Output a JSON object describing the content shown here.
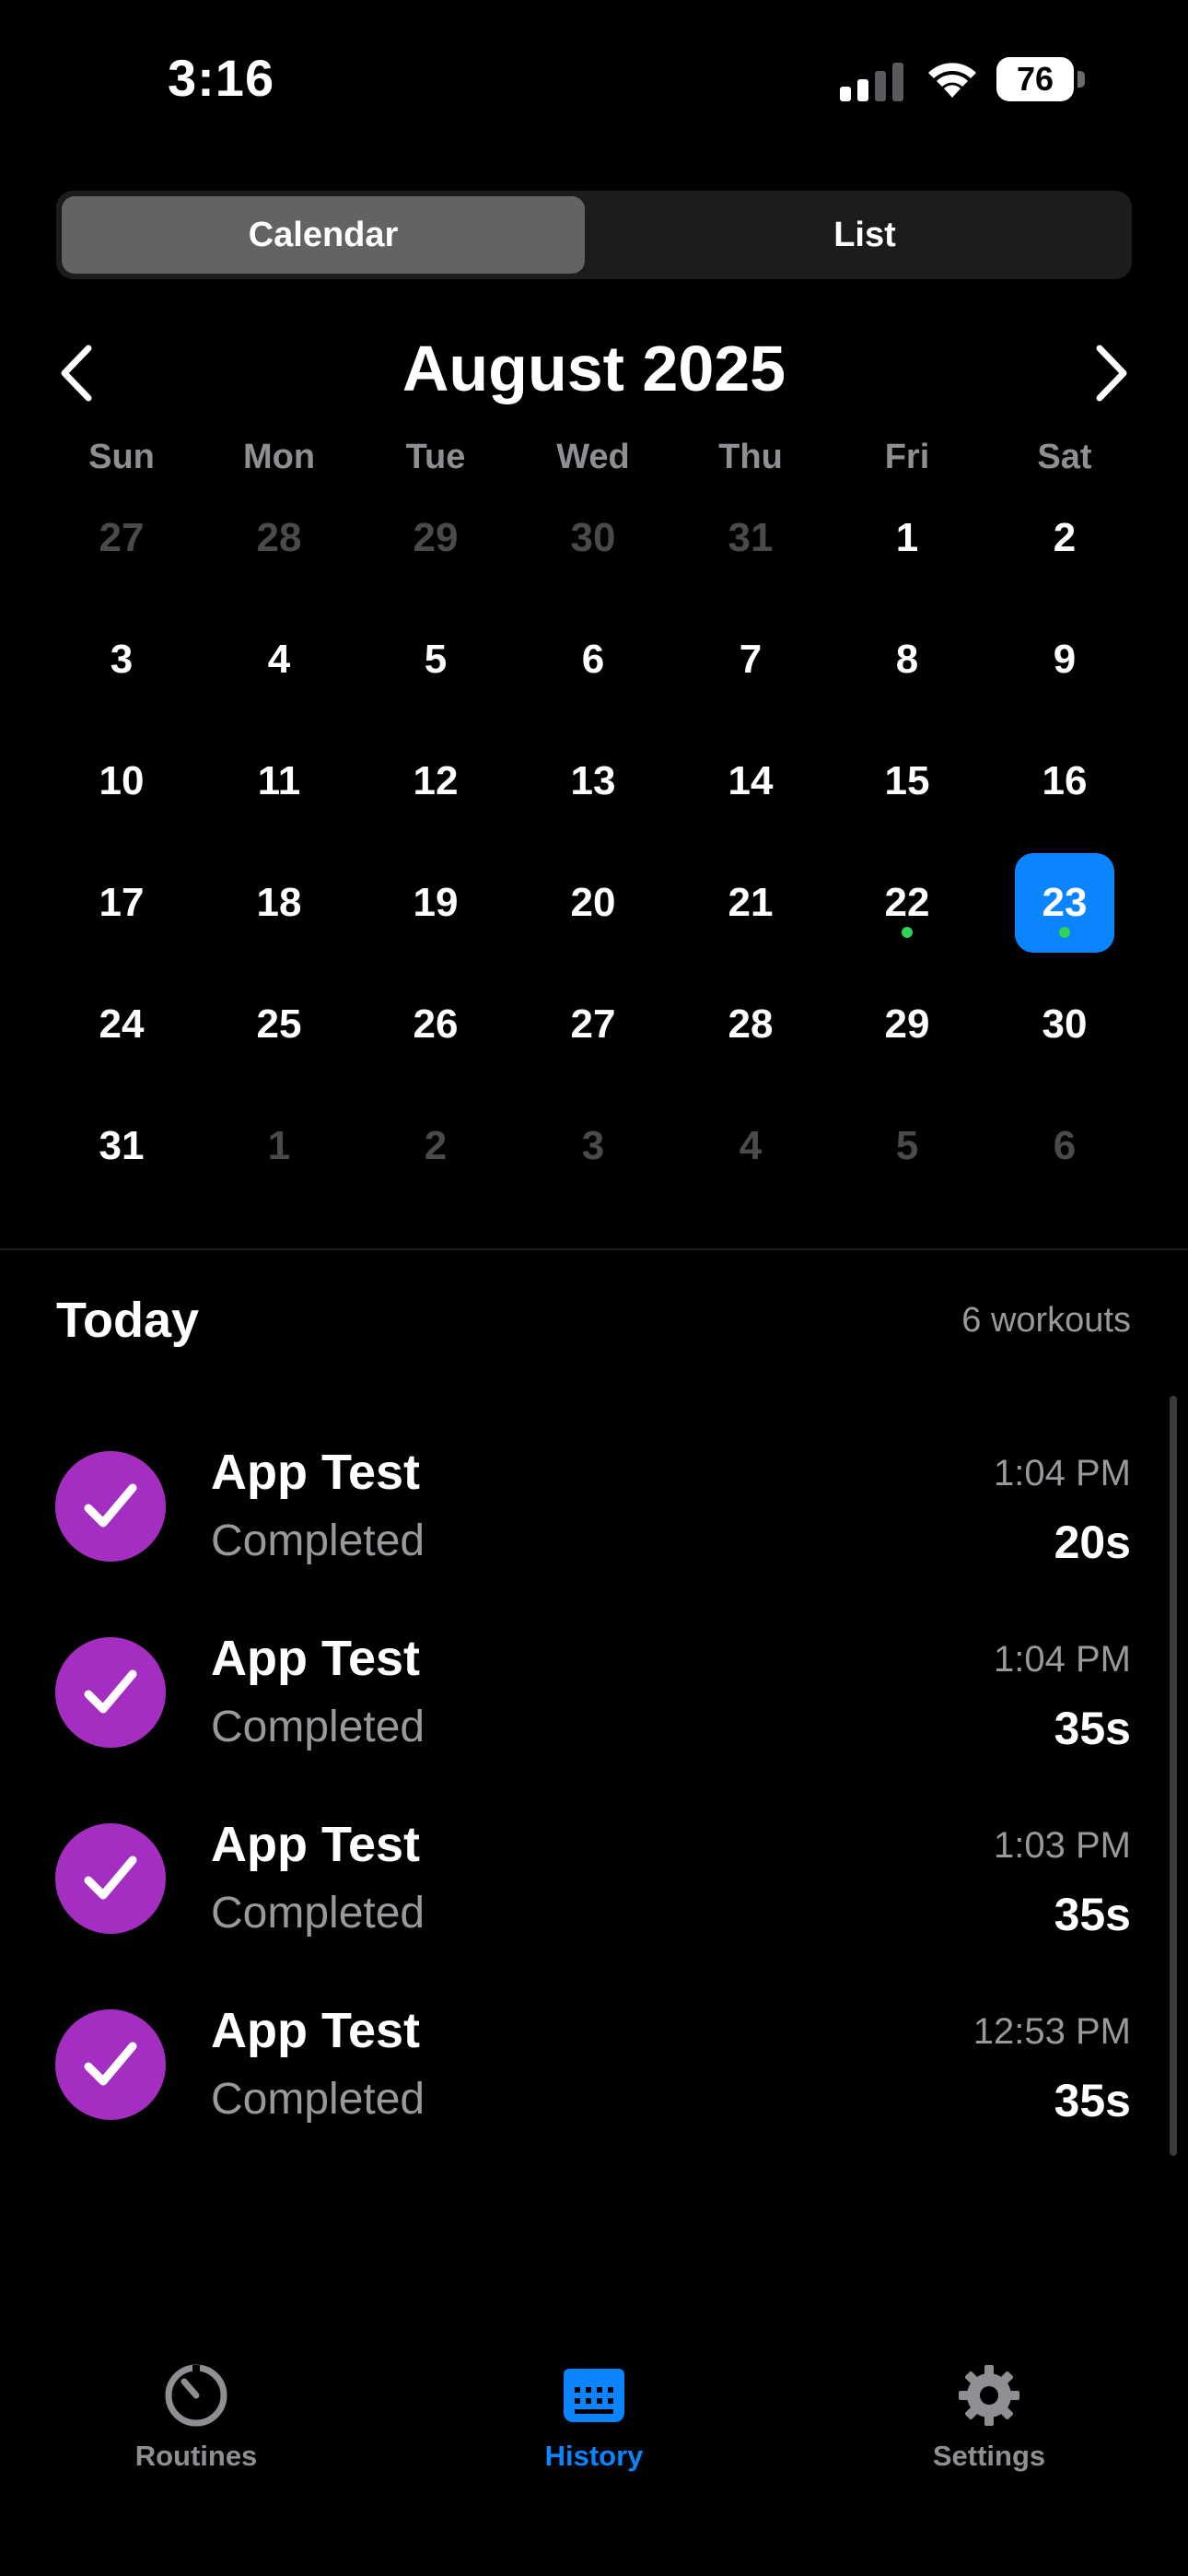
{
  "status_bar": {
    "time": "3:16",
    "battery": "76"
  },
  "segmented": {
    "calendar_label": "Calendar",
    "list_label": "List",
    "selected": "Calendar"
  },
  "calendar": {
    "month_title": "August 2025",
    "weekdays": [
      "Sun",
      "Mon",
      "Tue",
      "Wed",
      "Thu",
      "Fri",
      "Sat"
    ],
    "weeks": [
      [
        {
          "d": "27",
          "muted": true
        },
        {
          "d": "28",
          "muted": true
        },
        {
          "d": "29",
          "muted": true
        },
        {
          "d": "30",
          "muted": true
        },
        {
          "d": "31",
          "muted": true
        },
        {
          "d": "1"
        },
        {
          "d": "2"
        }
      ],
      [
        {
          "d": "3"
        },
        {
          "d": "4"
        },
        {
          "d": "5"
        },
        {
          "d": "6"
        },
        {
          "d": "7"
        },
        {
          "d": "8"
        },
        {
          "d": "9"
        }
      ],
      [
        {
          "d": "10"
        },
        {
          "d": "11"
        },
        {
          "d": "12"
        },
        {
          "d": "13"
        },
        {
          "d": "14"
        },
        {
          "d": "15"
        },
        {
          "d": "16"
        }
      ],
      [
        {
          "d": "17"
        },
        {
          "d": "18"
        },
        {
          "d": "19"
        },
        {
          "d": "20"
        },
        {
          "d": "21"
        },
        {
          "d": "22",
          "dot": true
        },
        {
          "d": "23",
          "selected": true,
          "dot": true
        }
      ],
      [
        {
          "d": "24"
        },
        {
          "d": "25"
        },
        {
          "d": "26"
        },
        {
          "d": "27"
        },
        {
          "d": "28"
        },
        {
          "d": "29"
        },
        {
          "d": "30"
        }
      ],
      [
        {
          "d": "31"
        },
        {
          "d": "1",
          "muted": true
        },
        {
          "d": "2",
          "muted": true
        },
        {
          "d": "3",
          "muted": true
        },
        {
          "d": "4",
          "muted": true
        },
        {
          "d": "5",
          "muted": true
        },
        {
          "d": "6",
          "muted": true
        }
      ]
    ],
    "colors": {
      "selected": "#0a84ff",
      "dot": "#30d158"
    }
  },
  "today": {
    "title": "Today",
    "count": "6 workouts"
  },
  "workouts": [
    {
      "name": "App Test",
      "status": "Completed",
      "time": "1:04 PM",
      "duration": "20s"
    },
    {
      "name": "App Test",
      "status": "Completed",
      "time": "1:04 PM",
      "duration": "35s"
    },
    {
      "name": "App Test",
      "status": "Completed",
      "time": "1:03 PM",
      "duration": "35s"
    },
    {
      "name": "App Test",
      "status": "Completed",
      "time": "12:53 PM",
      "duration": "35s"
    }
  ],
  "check_color": "#a52ec2",
  "tabbar": {
    "tabs": [
      {
        "label": "Routines",
        "icon": "timer-icon"
      },
      {
        "label": "History",
        "icon": "calendar-icon",
        "active": true
      },
      {
        "label": "Settings",
        "icon": "gear-icon"
      }
    ]
  }
}
